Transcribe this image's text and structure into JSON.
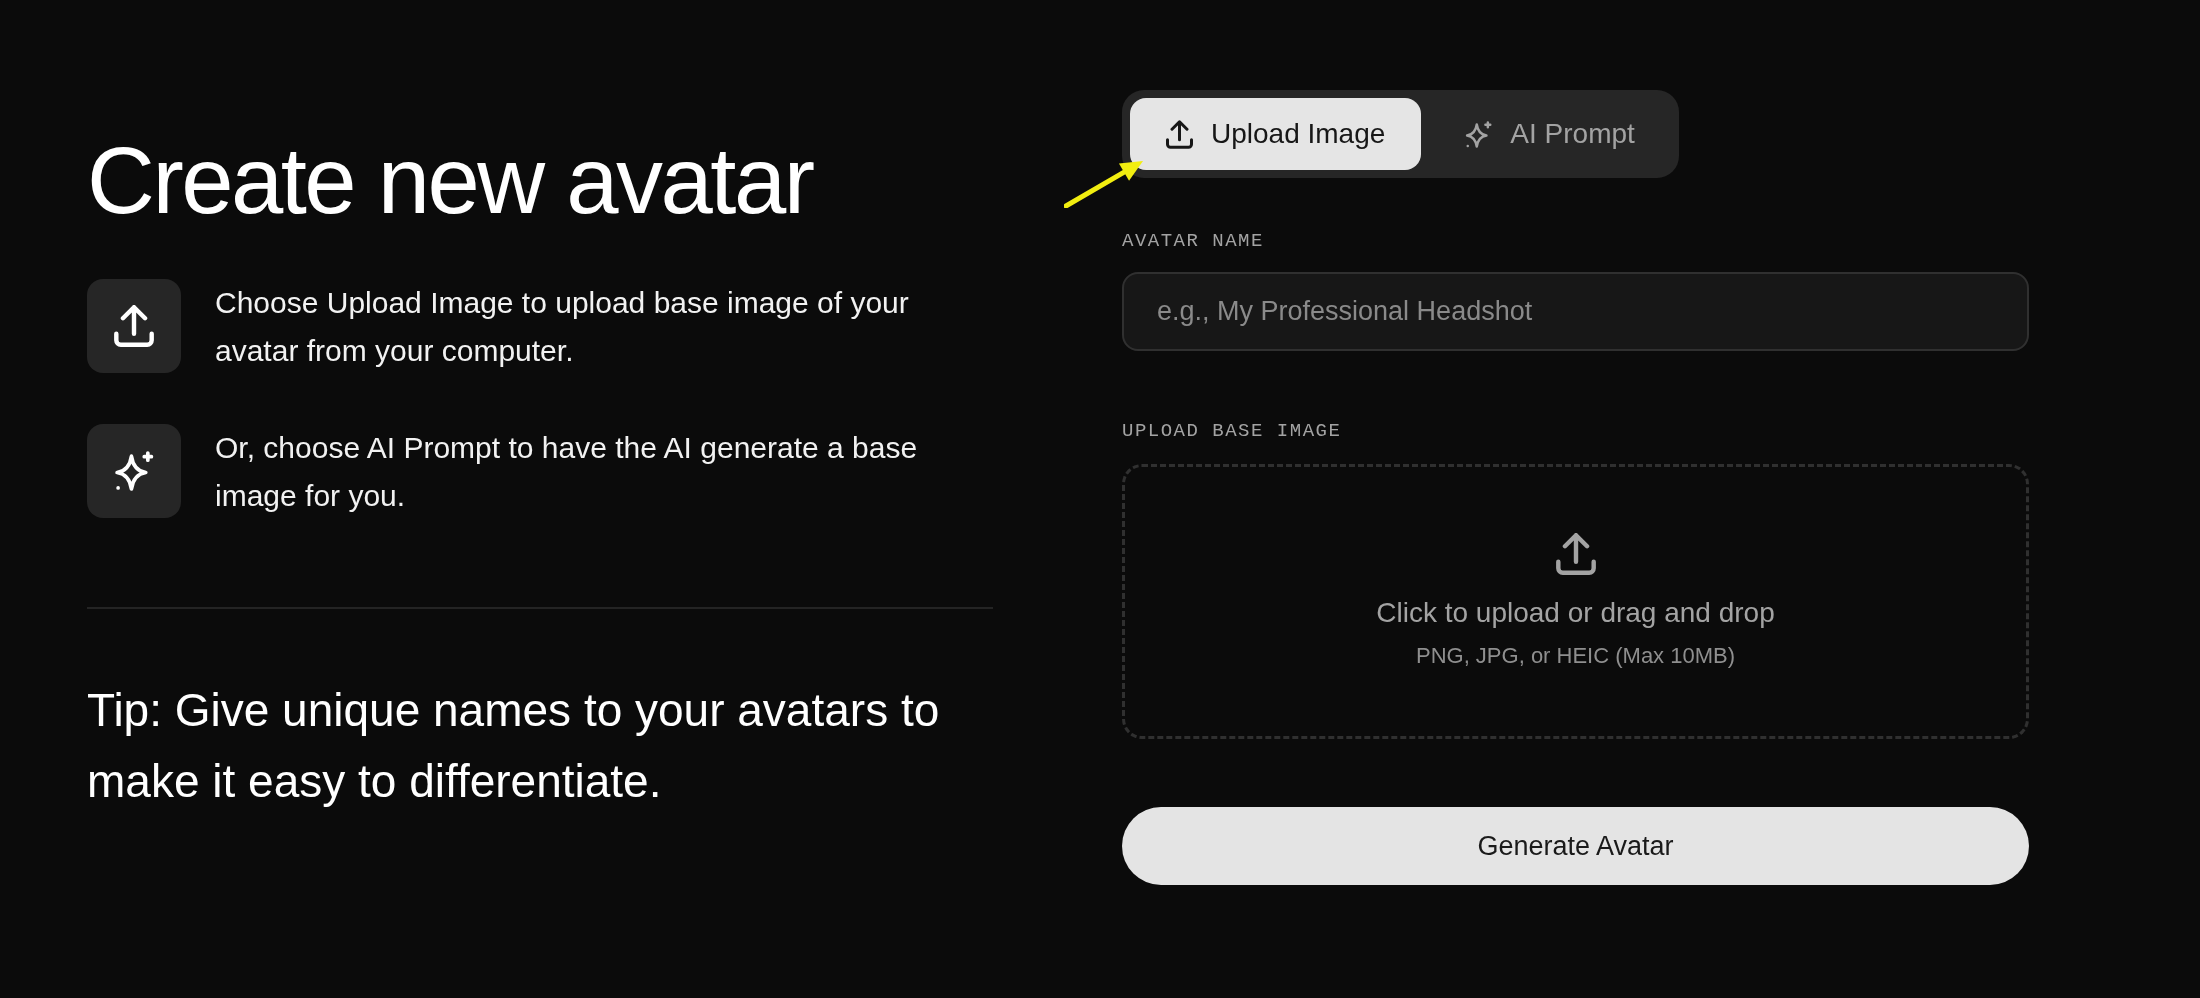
{
  "heading": {
    "title": "Create new avatar"
  },
  "steps": [
    {
      "kind": "upload",
      "text": "Choose Upload Image to upload base image of your avatar from your computer."
    },
    {
      "kind": "sparkle",
      "text": "Or, choose AI Prompt to have the AI generate a base image for you."
    }
  ],
  "tip": "Tip: Give unique names to your avatars to make it easy to differentiate.",
  "tabs": [
    {
      "label": "Upload Image",
      "kind": "upload",
      "selected": true
    },
    {
      "label": "AI Prompt",
      "kind": "sparkle",
      "selected": false
    }
  ],
  "avatar_name": {
    "label": "AVATAR NAME",
    "placeholder": "e.g., My Professional Headshot"
  },
  "upload": {
    "label": "UPLOAD BASE IMAGE",
    "prompt": "Click to upload or drag and drop",
    "hint": "PNG, JPG, or HEIC (Max 10MB)"
  },
  "submit_button": "Generate Avatar"
}
